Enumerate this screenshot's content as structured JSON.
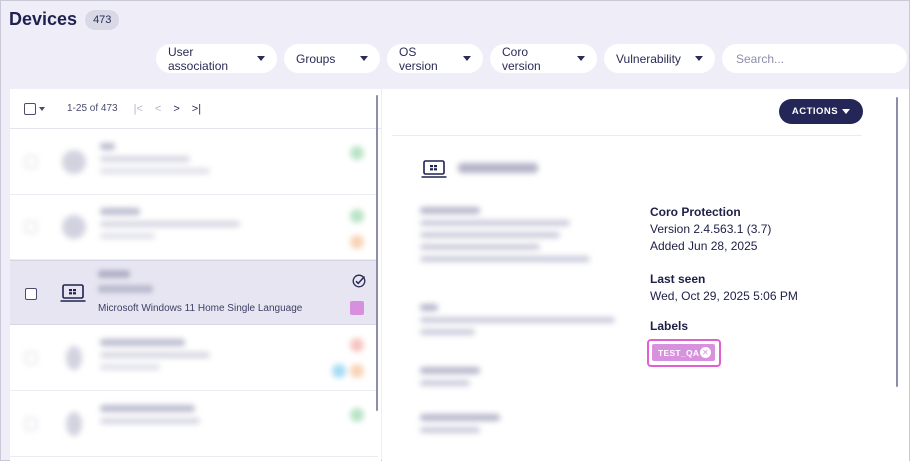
{
  "header": {
    "title": "Devices",
    "count": "473"
  },
  "filters": {
    "items": [
      "User association",
      "Groups",
      "OS version",
      "Coro version",
      "Vulnerability"
    ],
    "search_placeholder": "Search..."
  },
  "list": {
    "pager_range": "1-25 of 473",
    "pager_icons": [
      "first-page-icon",
      "prev-page-icon",
      "next-page-icon",
      "last-page-icon"
    ],
    "pager_glyphs": [
      "|<",
      "<",
      ">",
      ">|"
    ],
    "selected_row": {
      "os": "Microsoft Windows 11 Home Single Language",
      "label_color": "#d88fe0"
    }
  },
  "detail": {
    "actions_label": "ACTIONS",
    "coro_protection": {
      "label": "Coro Protection",
      "version": "Version 2.4.563.1 (3.7)",
      "added": "Added Jun 28, 2025"
    },
    "last_seen": {
      "label": "Last seen",
      "value": "Wed, Oct 29, 2025 5:06 PM"
    },
    "labels": {
      "label": "Labels",
      "chip": "TEST_QA",
      "chip_color": "#d891df",
      "highlight_color": "#e05fd5"
    }
  },
  "colors": {
    "accent_dark": "#232657",
    "background": "#efeef8"
  }
}
